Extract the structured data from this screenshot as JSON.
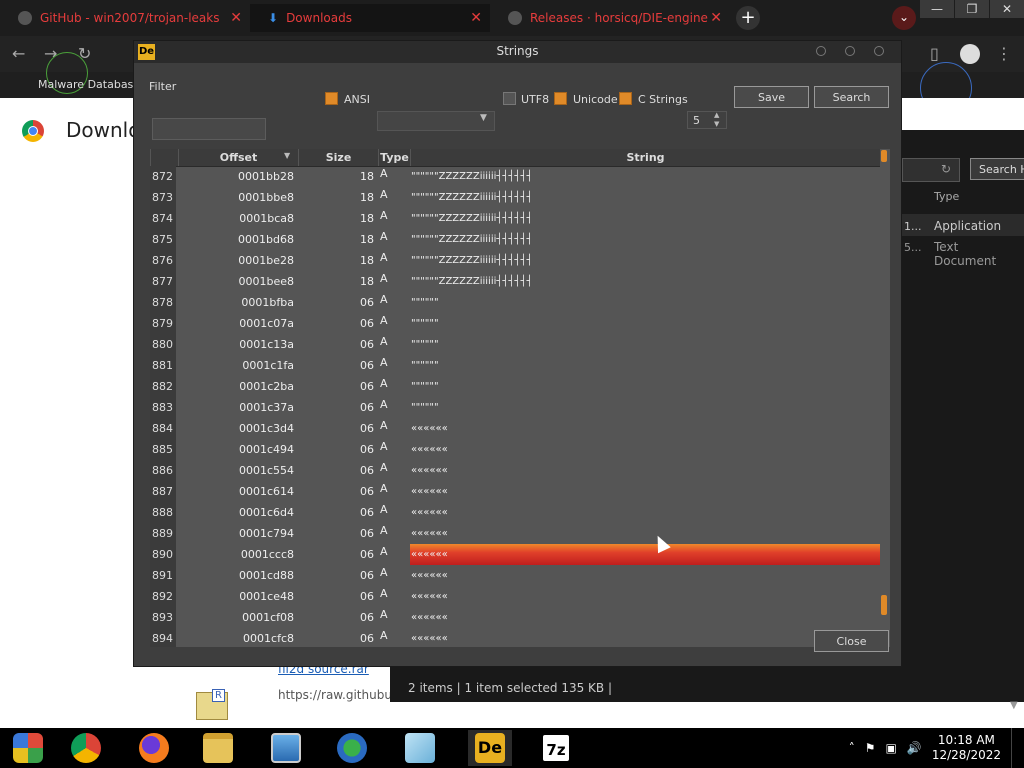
{
  "browser": {
    "tabs": [
      {
        "label": "GitHub - win2007/trojan-leaks"
      },
      {
        "label": "Downloads"
      },
      {
        "label": "Releases · horsicq/DIE-engine"
      }
    ],
    "tab_close": "✕",
    "new_tab": "+",
    "bookmark": "Malware Database"
  },
  "downloads_page": {
    "title": "Downloads",
    "file_link": "fil2d source.rar",
    "file_url": "https://raw.githubus"
  },
  "explorer": {
    "search_button": "Search H",
    "column_type": "Type",
    "rows": [
      {
        "n": "1...",
        "type": "Application"
      },
      {
        "n": "5...",
        "type": "Text Document"
      }
    ],
    "status": "2 items  |  1 item selected  135 KB  |"
  },
  "strings_dialog": {
    "title": "Strings",
    "app_icon_text": "De",
    "filter_label": "Filter",
    "filter_value": "",
    "ansi_label": "ANSI",
    "ansi_checked": true,
    "utf8_label": "UTF8",
    "utf8_checked": false,
    "unicode_label": "Unicode",
    "unicode_checked": true,
    "cstrings_label": "C Strings",
    "cstrings_checked": true,
    "cstrings_min": "5",
    "save_label": "Save",
    "search_label": "Search",
    "close_label": "Close",
    "columns": {
      "offset": "Offset",
      "size": "Size",
      "type": "Type",
      "string": "String"
    },
    "rows": [
      {
        "n": "872",
        "offset": "0001bb28",
        "size": "18",
        "type": "A",
        "string": "\"\"\"\"\"\"ZZZZZZiiiiii┤┤┤┤┤┤"
      },
      {
        "n": "873",
        "offset": "0001bbe8",
        "size": "18",
        "type": "A",
        "string": "\"\"\"\"\"\"ZZZZZZiiiiii┤┤┤┤┤┤"
      },
      {
        "n": "874",
        "offset": "0001bca8",
        "size": "18",
        "type": "A",
        "string": "\"\"\"\"\"\"ZZZZZZiiiiii┤┤┤┤┤┤"
      },
      {
        "n": "875",
        "offset": "0001bd68",
        "size": "18",
        "type": "A",
        "string": "\"\"\"\"\"\"ZZZZZZiiiiii┤┤┤┤┤┤"
      },
      {
        "n": "876",
        "offset": "0001be28",
        "size": "18",
        "type": "A",
        "string": "\"\"\"\"\"\"ZZZZZZiiiiii┤┤┤┤┤┤"
      },
      {
        "n": "877",
        "offset": "0001bee8",
        "size": "18",
        "type": "A",
        "string": "\"\"\"\"\"\"ZZZZZZiiiiii┤┤┤┤┤┤"
      },
      {
        "n": "878",
        "offset": "0001bfba",
        "size": "06",
        "type": "A",
        "string": "\"\"\"\"\"\""
      },
      {
        "n": "879",
        "offset": "0001c07a",
        "size": "06",
        "type": "A",
        "string": "\"\"\"\"\"\""
      },
      {
        "n": "880",
        "offset": "0001c13a",
        "size": "06",
        "type": "A",
        "string": "\"\"\"\"\"\""
      },
      {
        "n": "881",
        "offset": "0001c1fa",
        "size": "06",
        "type": "A",
        "string": "\"\"\"\"\"\""
      },
      {
        "n": "882",
        "offset": "0001c2ba",
        "size": "06",
        "type": "A",
        "string": "\"\"\"\"\"\""
      },
      {
        "n": "883",
        "offset": "0001c37a",
        "size": "06",
        "type": "A",
        "string": "\"\"\"\"\"\""
      },
      {
        "n": "884",
        "offset": "0001c3d4",
        "size": "06",
        "type": "A",
        "string": "««««««"
      },
      {
        "n": "885",
        "offset": "0001c494",
        "size": "06",
        "type": "A",
        "string": "««««««"
      },
      {
        "n": "886",
        "offset": "0001c554",
        "size": "06",
        "type": "A",
        "string": "««««««"
      },
      {
        "n": "887",
        "offset": "0001c614",
        "size": "06",
        "type": "A",
        "string": "««««««"
      },
      {
        "n": "888",
        "offset": "0001c6d4",
        "size": "06",
        "type": "A",
        "string": "««««««"
      },
      {
        "n": "889",
        "offset": "0001c794",
        "size": "06",
        "type": "A",
        "string": "««««««"
      },
      {
        "n": "890",
        "offset": "0001ccc8",
        "size": "06",
        "type": "A",
        "string": "««««««",
        "selected": true
      },
      {
        "n": "891",
        "offset": "0001cd88",
        "size": "06",
        "type": "A",
        "string": "««««««"
      },
      {
        "n": "892",
        "offset": "0001ce48",
        "size": "06",
        "type": "A",
        "string": "««««««"
      },
      {
        "n": "893",
        "offset": "0001cf08",
        "size": "06",
        "type": "A",
        "string": "««««««"
      },
      {
        "n": "894",
        "offset": "0001cfc8",
        "size": "06",
        "type": "A",
        "string": "««««««"
      }
    ]
  },
  "taskbar": {
    "apps": [
      "windows-start",
      "chrome",
      "firefox",
      "file-explorer",
      "image-viewer",
      "network-tool",
      "notepad",
      "detect-it-easy",
      "7zip"
    ],
    "die_label": "De",
    "sevenzip_label": "7z",
    "time": "10:18 AM",
    "date": "12/28/2022"
  },
  "colors": {
    "accent": "#e08a28",
    "selection": "#d8362a",
    "browser_tab_text": "#e63c3c"
  }
}
